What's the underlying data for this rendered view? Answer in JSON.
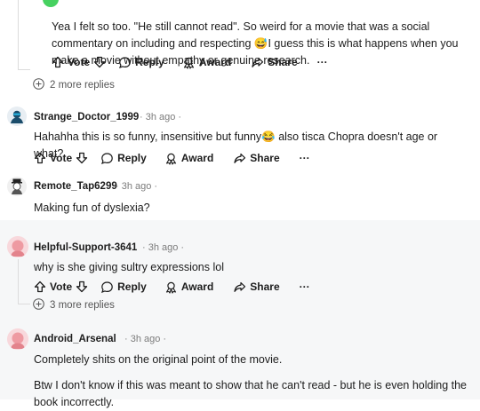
{
  "comments": [
    {
      "text": "Yea I felt so too. \"He still cannot read\". So weird for a movie that was a social commentary on including and respecting 😅I guess this is what happens when you make a movie without empathy or genuine research.",
      "more_replies": "2 more replies"
    },
    {
      "username": "Strange_Doctor_1999",
      "time": "· 3h ago ·",
      "text": "Hahahha this is so funny, insensitive but funny😂 also tisca Chopra doesn't age or what?"
    },
    {
      "username": "Remote_Tap6299",
      "time": "· 3h ago ·",
      "text": "Making fun of dyslexia?"
    },
    {
      "username": "Helpful-Support-3641",
      "time": "· 3h ago ·",
      "text": "why is she giving sultry expressions lol",
      "more_replies": "3 more replies"
    },
    {
      "username": "Android_Arsenal",
      "time": "· 3h ago ·",
      "text": "Completely shits on the original point of the movie.",
      "text2": "Btw I don't know if this was meant to show that he can't read - but he is even holding the book incorrectly."
    }
  ],
  "actions": {
    "vote": "Vote",
    "reply": "Reply",
    "award": "Award",
    "share": "Share",
    "more": "···"
  },
  "colors": {
    "avatar_green": "#46d160",
    "avatar_navy": "#1b4d6b",
    "avatar_pink": "#ee9aa2",
    "band_gray": "#f6f7f8"
  },
  "icons": [
    "upvote-icon",
    "downvote-icon",
    "reply-icon",
    "award-icon",
    "share-icon",
    "more-icon",
    "plus-circle-icon"
  ]
}
